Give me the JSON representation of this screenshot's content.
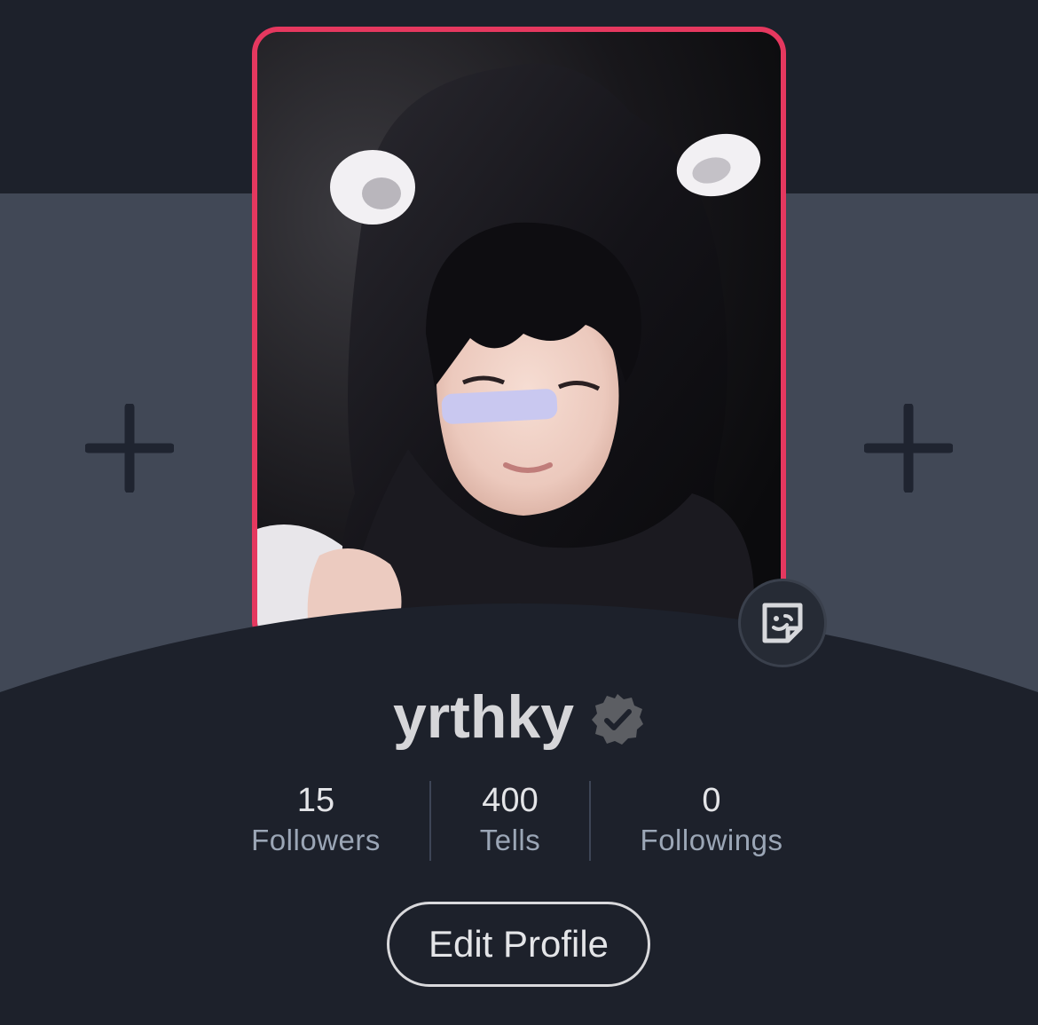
{
  "profile": {
    "username": "yrthky",
    "verified": true,
    "photo_border_color": "#e5385f"
  },
  "stats": {
    "followers": {
      "value": "15",
      "label": "Followers"
    },
    "tells": {
      "value": "400",
      "label": "Tells"
    },
    "followings": {
      "value": "0",
      "label": "Followings"
    }
  },
  "actions": {
    "edit_profile_label": "Edit Profile"
  },
  "icons": {
    "add_left": "plus-icon",
    "add_right": "plus-icon",
    "sticker": "sticker-icon",
    "verified": "verified-badge-icon"
  },
  "colors": {
    "background": "#1d212b",
    "cover_band": "#414856",
    "accent": "#e5385f"
  }
}
